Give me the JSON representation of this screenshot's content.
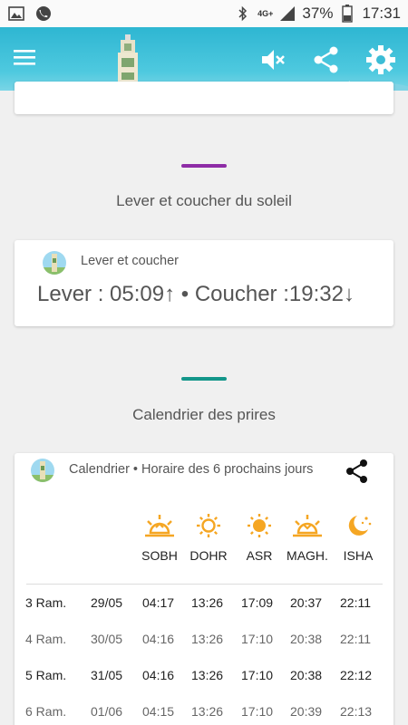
{
  "status_bar": {
    "network": "4G+",
    "battery": "37%",
    "time": "17:31"
  },
  "appbar": {
    "menu_icon": "hamburger-icon",
    "mute_icon": "speaker-muted-icon",
    "share_icon": "share-icon",
    "settings_icon": "gear-icon"
  },
  "sun": {
    "section_title": "Lever et coucher du soleil",
    "card_label": "Lever et coucher",
    "text": "Lever : 05:09↑ • Coucher :19:32↓"
  },
  "calendar": {
    "section_title": "Calendrier des prires",
    "card_label": "Calendrier • Horaire des 6 prochains jours",
    "prayers": [
      "SOBH",
      "DOHR",
      "ASR",
      "MAGH.",
      "ISHA"
    ],
    "rows": [
      [
        "3 Ram.",
        "29/05",
        "04:17",
        "13:26",
        "17:09",
        "20:37",
        "22:11"
      ],
      [
        "4 Ram.",
        "30/05",
        "04:16",
        "13:26",
        "17:10",
        "20:38",
        "22:11"
      ],
      [
        "5 Ram.",
        "31/05",
        "04:16",
        "13:26",
        "17:10",
        "20:38",
        "22:12"
      ],
      [
        "6 Ram.",
        "01/06",
        "04:15",
        "13:26",
        "17:10",
        "20:39",
        "22:13"
      ]
    ]
  },
  "colors": {
    "purple_divider": "#8e2ca6",
    "teal_divider": "#13968a",
    "icon_orange": "#f5a623"
  }
}
